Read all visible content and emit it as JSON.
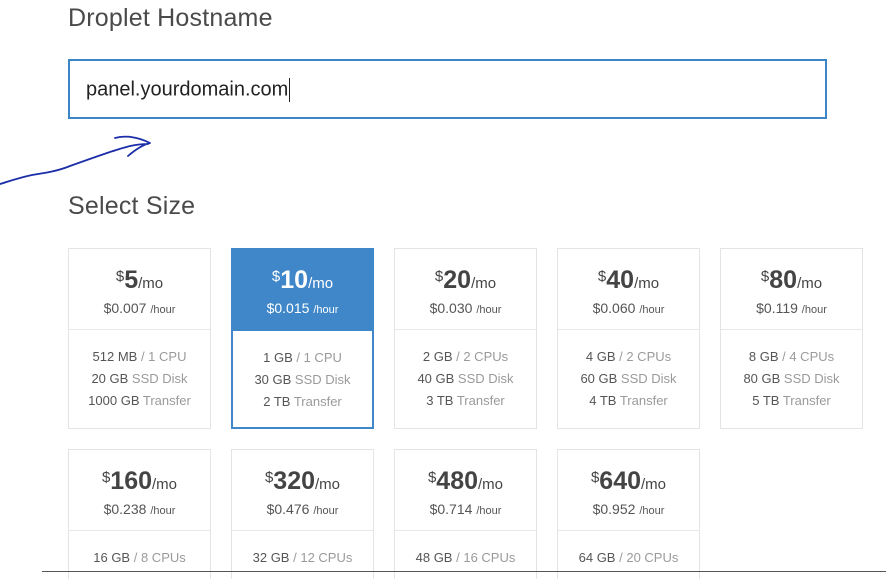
{
  "hostname": {
    "title": "Droplet Hostname",
    "value": "panel.yourdomain.com"
  },
  "size": {
    "title": "Select Size",
    "selected_index": 1,
    "plans": [
      {
        "currency": "$",
        "amount": "5",
        "per": "/mo",
        "hourly": "$0.007",
        "hourly_unit": "/hour",
        "memory": "512 MB",
        "cpu": "/ 1 CPU",
        "disk": "20 GB",
        "disk_unit": "SSD Disk",
        "transfer": "1000 GB",
        "transfer_unit": "Transfer"
      },
      {
        "currency": "$",
        "amount": "10",
        "per": "/mo",
        "hourly": "$0.015",
        "hourly_unit": "/hour",
        "memory": "1 GB",
        "cpu": "/ 1 CPU",
        "disk": "30 GB",
        "disk_unit": "SSD Disk",
        "transfer": "2 TB",
        "transfer_unit": "Transfer"
      },
      {
        "currency": "$",
        "amount": "20",
        "per": "/mo",
        "hourly": "$0.030",
        "hourly_unit": "/hour",
        "memory": "2 GB",
        "cpu": "/ 2 CPUs",
        "disk": "40 GB",
        "disk_unit": "SSD Disk",
        "transfer": "3 TB",
        "transfer_unit": "Transfer"
      },
      {
        "currency": "$",
        "amount": "40",
        "per": "/mo",
        "hourly": "$0.060",
        "hourly_unit": "/hour",
        "memory": "4 GB",
        "cpu": "/ 2 CPUs",
        "disk": "60 GB",
        "disk_unit": "SSD Disk",
        "transfer": "4 TB",
        "transfer_unit": "Transfer"
      },
      {
        "currency": "$",
        "amount": "80",
        "per": "/mo",
        "hourly": "$0.119",
        "hourly_unit": "/hour",
        "memory": "8 GB",
        "cpu": "/ 4 CPUs",
        "disk": "80 GB",
        "disk_unit": "SSD Disk",
        "transfer": "5 TB",
        "transfer_unit": "Transfer"
      },
      {
        "currency": "$",
        "amount": "160",
        "per": "/mo",
        "hourly": "$0.238",
        "hourly_unit": "/hour",
        "memory": "16 GB",
        "cpu": "/ 8 CPUs"
      },
      {
        "currency": "$",
        "amount": "320",
        "per": "/mo",
        "hourly": "$0.476",
        "hourly_unit": "/hour",
        "memory": "32 GB",
        "cpu": "/ 12 CPUs"
      },
      {
        "currency": "$",
        "amount": "480",
        "per": "/mo",
        "hourly": "$0.714",
        "hourly_unit": "/hour",
        "memory": "48 GB",
        "cpu": "/ 16 CPUs"
      },
      {
        "currency": "$",
        "amount": "640",
        "per": "/mo",
        "hourly": "$0.952",
        "hourly_unit": "/hour",
        "memory": "64 GB",
        "cpu": "/ 20 CPUs"
      }
    ]
  },
  "colors": {
    "accent": "#3f87c8",
    "annotation": "#1b2ea8"
  },
  "annotation": {
    "icon": "hand-drawn-arrow-icon"
  }
}
